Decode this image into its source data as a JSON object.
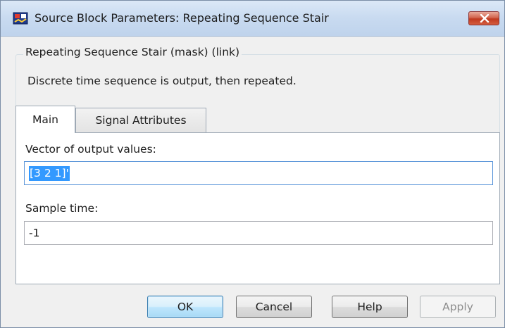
{
  "window": {
    "title": "Source Block Parameters: Repeating Sequence Stair",
    "icon": "simulink-block-icon",
    "close_icon": "close-x-icon"
  },
  "group": {
    "label": "Repeating Sequence Stair (mask) (link)",
    "description": "Discrete time sequence is output, then repeated."
  },
  "tabs": [
    {
      "label": "Main",
      "selected": true
    },
    {
      "label": "Signal Attributes",
      "selected": false
    }
  ],
  "fields": {
    "output_values": {
      "label": "Vector of output values:",
      "value": "[3 2 1]'"
    },
    "sample_time": {
      "label": "Sample time:",
      "value": "-1"
    }
  },
  "buttons": {
    "ok": "OK",
    "cancel": "Cancel",
    "help": "Help",
    "apply": "Apply"
  },
  "colors": {
    "selection": "#3399ff",
    "close_button": "#c7432a",
    "default_button_border": "#3c7fb1"
  }
}
